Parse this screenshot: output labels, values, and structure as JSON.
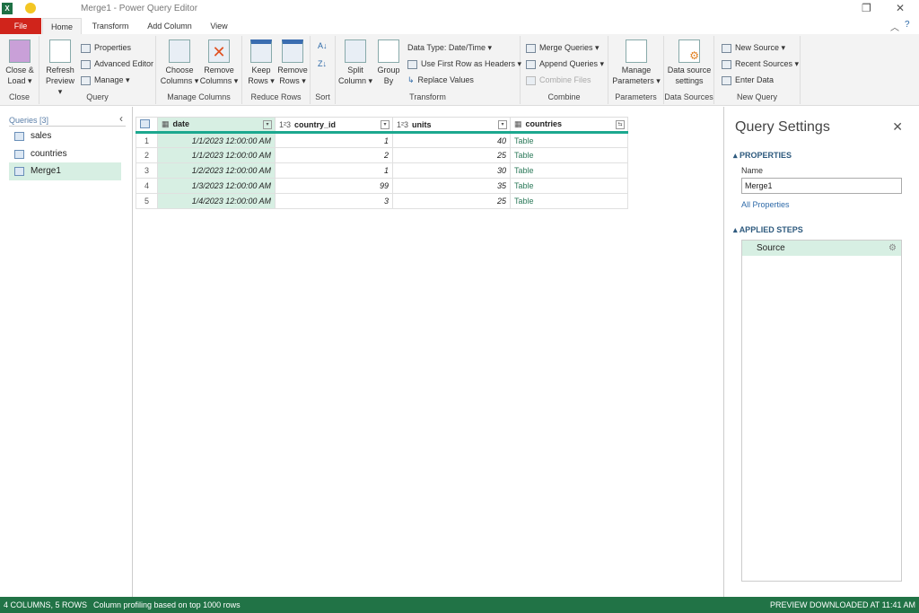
{
  "title": "Merge1 - Power Query Editor",
  "tabs": [
    "File",
    "Home",
    "Transform",
    "Add Column",
    "View"
  ],
  "ribbon": {
    "close": {
      "label1": "Close &",
      "label2": "Load ▾",
      "group": "Close"
    },
    "query": {
      "refresh1": "Refresh",
      "refresh2": "Preview ▾",
      "properties": "Properties",
      "advanced": "Advanced Editor",
      "manage": "Manage ▾",
      "group": "Query"
    },
    "manage_columns": {
      "choose1": "Choose",
      "choose2": "Columns ▾",
      "remove1": "Remove",
      "remove2": "Columns ▾",
      "group": "Manage Columns"
    },
    "reduce_rows": {
      "keep1": "Keep",
      "keep2": "Rows ▾",
      "remove1": "Remove",
      "remove2": "Rows ▾",
      "group": "Reduce Rows"
    },
    "sort": {
      "group": "Sort"
    },
    "transform": {
      "split1": "Split",
      "split2": "Column ▾",
      "group1": "Group",
      "group2": "By",
      "datatype": "Data Type: Date/Time ▾",
      "firstrow": "Use First Row as Headers ▾",
      "replace": "Replace Values",
      "group": "Transform"
    },
    "combine": {
      "merge": "Merge Queries ▾",
      "append": "Append Queries ▾",
      "files": "Combine Files",
      "group": "Combine"
    },
    "parameters": {
      "l1": "Manage",
      "l2": "Parameters ▾",
      "group": "Parameters"
    },
    "datasources": {
      "l1": "Data source",
      "l2": "settings",
      "group": "Data Sources"
    },
    "newquery": {
      "newsource": "New Source ▾",
      "recent": "Recent Sources ▾",
      "enter": "Enter Data",
      "group": "New Query"
    }
  },
  "queries": {
    "header": "Queries [3]",
    "items": [
      "sales",
      "countries",
      "Merge1"
    ],
    "selected": "Merge1"
  },
  "table": {
    "columns": [
      {
        "type": "",
        "name": "date"
      },
      {
        "type": "1²3",
        "name": "country_id"
      },
      {
        "type": "1²3",
        "name": "units"
      },
      {
        "type": "",
        "name": "countries"
      }
    ],
    "rows": [
      [
        "1",
        "1/1/2023 12:00:00 AM",
        "1",
        "40",
        "Table"
      ],
      [
        "2",
        "1/1/2023 12:00:00 AM",
        "2",
        "25",
        "Table"
      ],
      [
        "3",
        "1/2/2023 12:00:00 AM",
        "1",
        "30",
        "Table"
      ],
      [
        "4",
        "1/3/2023 12:00:00 AM",
        "99",
        "35",
        "Table"
      ],
      [
        "5",
        "1/4/2023 12:00:00 AM",
        "3",
        "25",
        "Table"
      ]
    ]
  },
  "settings": {
    "title": "Query Settings",
    "properties": "PROPERTIES",
    "name_label": "Name",
    "name_value": "Merge1",
    "all_properties": "All Properties",
    "applied_steps": "APPLIED STEPS",
    "steps": [
      "Source"
    ]
  },
  "status": {
    "left1": "4 COLUMNS, 5 ROWS",
    "left2": "Column profiling based on top 1000 rows",
    "right": "PREVIEW DOWNLOADED AT 11:41 AM"
  }
}
